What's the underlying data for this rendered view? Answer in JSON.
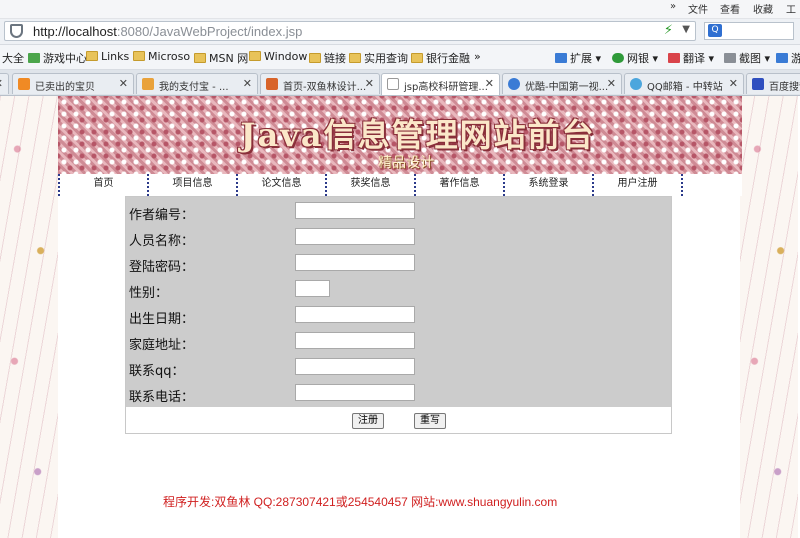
{
  "browser": {
    "menu": {
      "more": "»",
      "file": "文件",
      "view": "查看",
      "favorites": "收藏",
      "tools": "工具"
    },
    "url_host": "http://localhost",
    "url_rest": ":8080/JavaWebProject/index.jsp",
    "favorites": [
      {
        "label": "大全"
      },
      {
        "label": "游戏中心"
      },
      {
        "label": "Links"
      },
      {
        "label": "Microso"
      },
      {
        "label": "MSN 网"
      },
      {
        "label": "Window"
      },
      {
        "label": "链接"
      },
      {
        "label": "实用查询"
      },
      {
        "label": "银行金融"
      }
    ],
    "fav_more": "»",
    "toolbar_right": [
      {
        "label": "扩展"
      },
      {
        "label": "网银"
      },
      {
        "label": "翻译"
      },
      {
        "label": "截图"
      },
      {
        "label": "游"
      }
    ],
    "tabs": [
      {
        "label": "已卖出的宝贝"
      },
      {
        "label": "我的支付宝 - ..."
      },
      {
        "label": "首页-双鱼林设计..."
      },
      {
        "label": "jsp高校科研管理..."
      },
      {
        "label": "优酷-中国第一视..."
      },
      {
        "label": "QQ邮箱 - 中转站"
      },
      {
        "label": "百度搜索"
      }
    ],
    "colors": {
      "accent": "#2f6fd1"
    }
  },
  "site": {
    "banner_title": "Java信息管理网站前台",
    "banner_subtitle": "精品设计",
    "nav": [
      {
        "label": "首页"
      },
      {
        "label": "项目信息"
      },
      {
        "label": "论文信息"
      },
      {
        "label": "获奖信息"
      },
      {
        "label": "著作信息"
      },
      {
        "label": "系统登录"
      },
      {
        "label": "用户注册"
      }
    ],
    "form": {
      "fields": [
        {
          "label": "作者编号：",
          "value": ""
        },
        {
          "label": "人员名称：",
          "value": ""
        },
        {
          "label": "登陆密码：",
          "value": ""
        },
        {
          "label": "性别：",
          "value": ""
        },
        {
          "label": "出生日期：",
          "value": ""
        },
        {
          "label": "家庭地址：",
          "value": ""
        },
        {
          "label": "联系qq：",
          "value": ""
        },
        {
          "label": "联系电话：",
          "value": ""
        }
      ],
      "submit_label": "注册",
      "reset_label": "重写"
    },
    "footer": "程序开发:双鱼林 QQ:287307421或254540457 网站:www.shuangyulin.com",
    "colors": {
      "footer": "#d02020",
      "form_bg": "#cccccc",
      "nav_divider": "#2b3a8a"
    }
  }
}
